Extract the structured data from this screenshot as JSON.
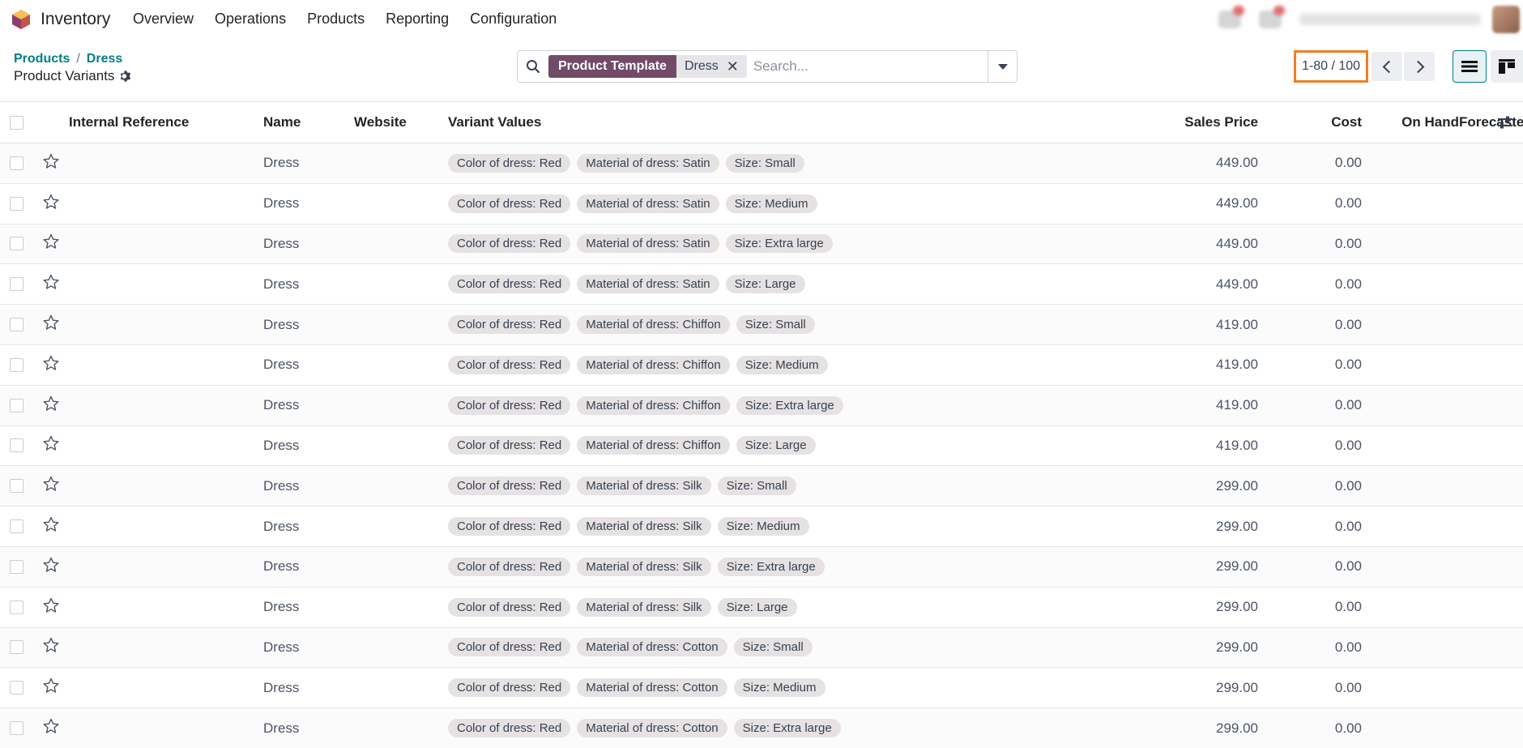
{
  "navbar": {
    "app_name": "Inventory",
    "menu": [
      "Overview",
      "Operations",
      "Products",
      "Reporting",
      "Configuration"
    ]
  },
  "breadcrumb": {
    "parent1": "Products",
    "parent2": "Dress",
    "separator": "/"
  },
  "page_title": "Product Variants",
  "search": {
    "facet_name": "Product Template",
    "facet_value": "Dress",
    "facet_close": "✕",
    "placeholder": "Search..."
  },
  "pager": {
    "value": "1-80 / 100"
  },
  "table": {
    "columns": [
      "Internal Reference",
      "Name",
      "Website",
      "Variant Values",
      "Sales Price",
      "Cost",
      "On Hand",
      "Forecasted"
    ],
    "rows": [
      {
        "name": "Dress",
        "tags": [
          "Color of dress: Red",
          "Material of dress: Satin",
          "Size: Small"
        ],
        "price": "449.00",
        "cost": "0.00"
      },
      {
        "name": "Dress",
        "tags": [
          "Color of dress: Red",
          "Material of dress: Satin",
          "Size: Medium"
        ],
        "price": "449.00",
        "cost": "0.00"
      },
      {
        "name": "Dress",
        "tags": [
          "Color of dress: Red",
          "Material of dress: Satin",
          "Size: Extra large"
        ],
        "price": "449.00",
        "cost": "0.00"
      },
      {
        "name": "Dress",
        "tags": [
          "Color of dress: Red",
          "Material of dress: Satin",
          "Size: Large"
        ],
        "price": "449.00",
        "cost": "0.00"
      },
      {
        "name": "Dress",
        "tags": [
          "Color of dress: Red",
          "Material of dress: Chiffon",
          "Size: Small"
        ],
        "price": "419.00",
        "cost": "0.00"
      },
      {
        "name": "Dress",
        "tags": [
          "Color of dress: Red",
          "Material of dress: Chiffon",
          "Size: Medium"
        ],
        "price": "419.00",
        "cost": "0.00"
      },
      {
        "name": "Dress",
        "tags": [
          "Color of dress: Red",
          "Material of dress: Chiffon",
          "Size: Extra large"
        ],
        "price": "419.00",
        "cost": "0.00"
      },
      {
        "name": "Dress",
        "tags": [
          "Color of dress: Red",
          "Material of dress: Chiffon",
          "Size: Large"
        ],
        "price": "419.00",
        "cost": "0.00"
      },
      {
        "name": "Dress",
        "tags": [
          "Color of dress: Red",
          "Material of dress: Silk",
          "Size: Small"
        ],
        "price": "299.00",
        "cost": "0.00"
      },
      {
        "name": "Dress",
        "tags": [
          "Color of dress: Red",
          "Material of dress: Silk",
          "Size: Medium"
        ],
        "price": "299.00",
        "cost": "0.00"
      },
      {
        "name": "Dress",
        "tags": [
          "Color of dress: Red",
          "Material of dress: Silk",
          "Size: Extra large"
        ],
        "price": "299.00",
        "cost": "0.00"
      },
      {
        "name": "Dress",
        "tags": [
          "Color of dress: Red",
          "Material of dress: Silk",
          "Size: Large"
        ],
        "price": "299.00",
        "cost": "0.00"
      },
      {
        "name": "Dress",
        "tags": [
          "Color of dress: Red",
          "Material of dress: Cotton",
          "Size: Small"
        ],
        "price": "299.00",
        "cost": "0.00"
      },
      {
        "name": "Dress",
        "tags": [
          "Color of dress: Red",
          "Material of dress: Cotton",
          "Size: Medium"
        ],
        "price": "299.00",
        "cost": "0.00"
      },
      {
        "name": "Dress",
        "tags": [
          "Color of dress: Red",
          "Material of dress: Cotton",
          "Size: Extra large"
        ],
        "price": "299.00",
        "cost": "0.00"
      }
    ]
  },
  "colors": {
    "brand": "#714b67",
    "accent": "#017e84",
    "highlight": "#f07f22"
  }
}
